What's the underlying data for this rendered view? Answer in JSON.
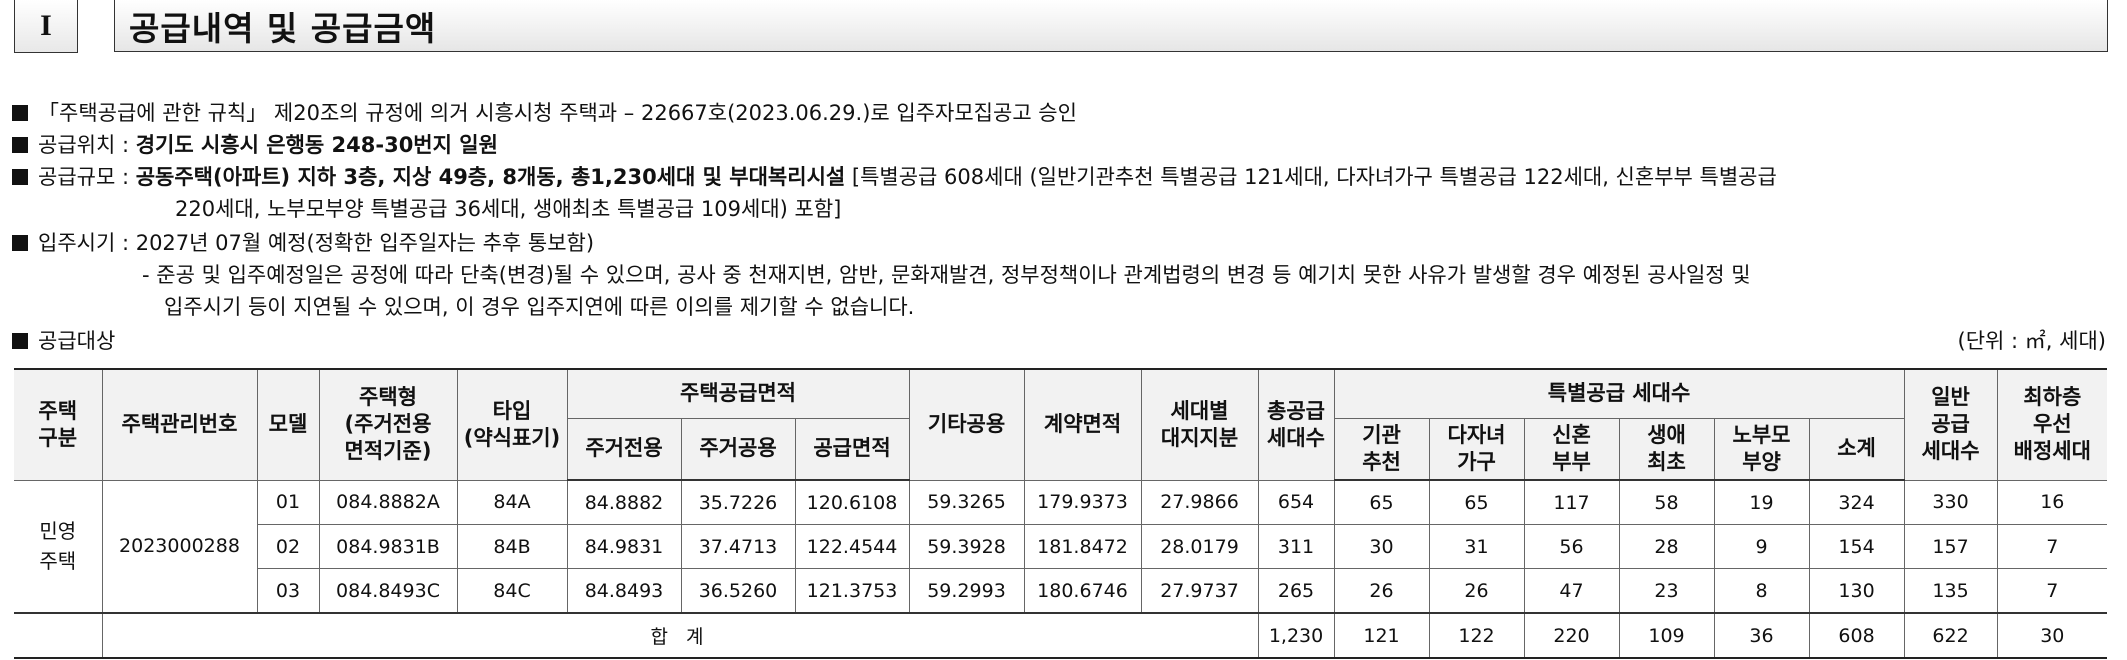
{
  "header": {
    "number": "I",
    "title": "공급내역 및 공급금액"
  },
  "lines": {
    "l1": "「주택공급에 관한 규칙」 제20조의 규정에 의거 시흥시청 주택과 – 22667호(2023.06.29.)로 입주자모집공고 승인",
    "l2_label": "공급위치 : ",
    "l2_value": "경기도 시흥시 은행동 248-30번지 일원",
    "l3_label": "공급규모 : ",
    "l3_bold": "공동주택(아파트) 지하 3층, 지상 49층, 8개동, 총1,230세대 및 부대복리시설",
    "l3_rest": " [특별공급 608세대 (일반기관추천 특별공급 121세대, 다자녀가구 특별공급 122세대, 신혼부부 특별공급",
    "l3_cont": "220세대, 노부모부양 특별공급 36세대, 생애최초 특별공급 109세대) 포함]",
    "l4": "입주시기 : 2027년 07월 예정(정확한 입주일자는 추후 통보함)",
    "l5": "- 준공 및 입주예정일은 공정에 따라 단축(변경)될 수 있으며, 공사 중 천재지변, 암반, 문화재발견, 정부정책이나 관계법령의 변경 등 예기치 못한 사유가 발생할 경우 예정된 공사일정 및",
    "l5_cont": "입주시기 등이 지연될 수 있으며, 이 경우 입주지연에 따른 이의를 제기할 수 없습니다.",
    "l6": "공급대상",
    "unit": "(단위 : ㎡, 세대)"
  },
  "table": {
    "h": {
      "housing_type": "주택\n구분",
      "mgmt_no": "주택관리번호",
      "model": "모델",
      "house_type": "주택형\n(주거전용\n면적기준)",
      "unit_type": "타입\n(약식표기)",
      "supply_area": "주택공급면적",
      "exclusive": "주거전용",
      "common": "주거공용",
      "supply_total": "공급면적",
      "other_common": "기타공용",
      "contract_area": "계약면적",
      "land_share": "세대별\n대지지분",
      "total_units": "총공급\n세대수",
      "special": "특별공급 세대수",
      "inst": "기관\n추천",
      "multi": "다자녀\n가구",
      "newlywed": "신혼\n부부",
      "first": "생애\n최초",
      "elderly": "노부모\n부양",
      "subtotal": "소계",
      "general": "일반\n공급\n세대수",
      "lowest": "최하층\n우선\n배정세대"
    },
    "group": "민영\n주택",
    "mgmt_no": "2023000288",
    "rows": [
      {
        "model": "01",
        "house_type": "084.8882A",
        "type": "84A",
        "exclusive": "84.8882",
        "common": "35.7226",
        "supply": "120.6108",
        "other": "59.3265",
        "contract": "179.9373",
        "land": "27.9866",
        "total": "654",
        "inst": "65",
        "multi": "65",
        "newlywed": "117",
        "first": "58",
        "elderly": "19",
        "subtotal": "324",
        "general": "330",
        "lowest": "16"
      },
      {
        "model": "02",
        "house_type": "084.9831B",
        "type": "84B",
        "exclusive": "84.9831",
        "common": "37.4713",
        "supply": "122.4544",
        "other": "59.3928",
        "contract": "181.8472",
        "land": "28.0179",
        "total": "311",
        "inst": "30",
        "multi": "31",
        "newlywed": "56",
        "first": "28",
        "elderly": "9",
        "subtotal": "154",
        "general": "157",
        "lowest": "7"
      },
      {
        "model": "03",
        "house_type": "084.8493C",
        "type": "84C",
        "exclusive": "84.8493",
        "common": "36.5260",
        "supply": "121.3753",
        "other": "59.2993",
        "contract": "180.6746",
        "land": "27.9737",
        "total": "265",
        "inst": "26",
        "multi": "26",
        "newlywed": "47",
        "first": "23",
        "elderly": "8",
        "subtotal": "130",
        "general": "135",
        "lowest": "7"
      }
    ],
    "total_row": {
      "label": "합 계",
      "total": "1,230",
      "inst": "121",
      "multi": "122",
      "newlywed": "220",
      "first": "109",
      "elderly": "36",
      "subtotal": "608",
      "general": "622",
      "lowest": "30"
    }
  }
}
